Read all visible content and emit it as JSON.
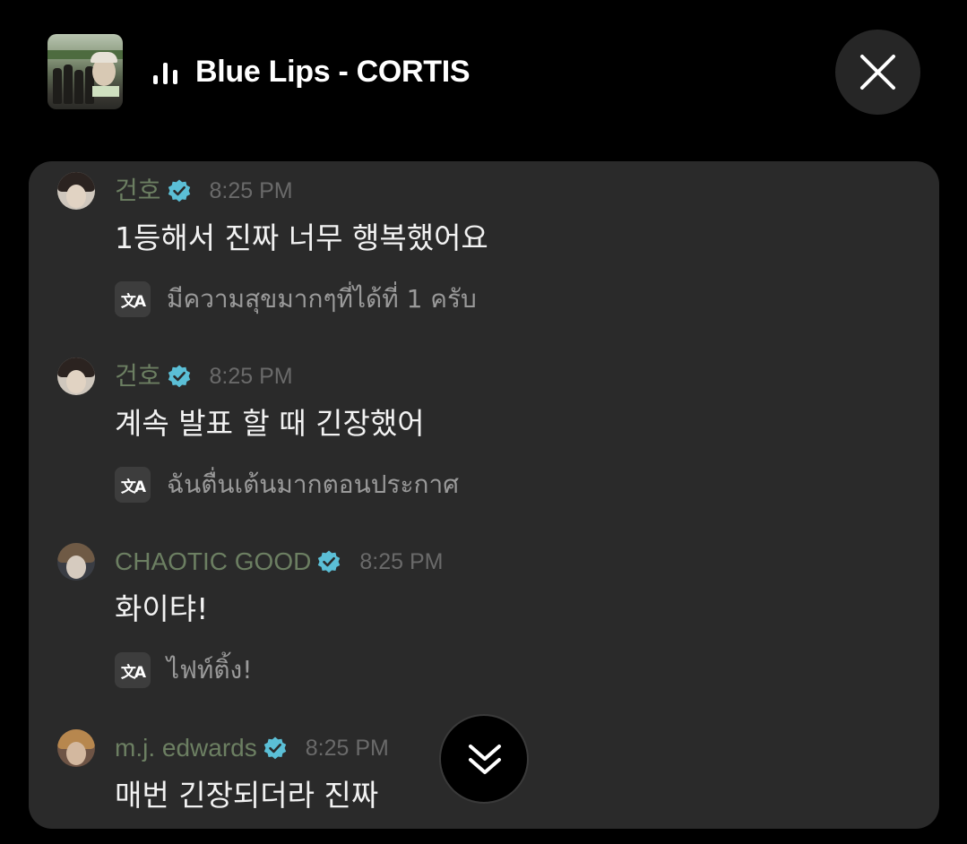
{
  "header": {
    "track_title": "Blue Lips - CORTIS",
    "now_playing_icon": "equalizer-icon",
    "album_art": "album-art-thumbnail",
    "close_icon": "close-icon"
  },
  "chat": {
    "messages": [
      {
        "username": "건호",
        "verified": true,
        "time": "8:25 PM",
        "text": "1등해서 진짜 너무 행복했어요",
        "translation": "มีความสุขมากๆที่ได้ที่ 1 ครับ"
      },
      {
        "username": "건호",
        "verified": true,
        "time": "8:25 PM",
        "text": "계속 발표 할 때 긴장했어",
        "translation": "ฉันตื่นเต้นมากตอนประกาศ"
      },
      {
        "username": "CHAOTIC GOOD",
        "verified": true,
        "time": "8:25 PM",
        "text": "화이탸!",
        "translation": "ไฟท์ติ้ง!"
      },
      {
        "username": "m.j. edwards",
        "verified": true,
        "time": "8:25 PM",
        "text": "매번 긴장되더라 진짜",
        "translation": ""
      }
    ],
    "translate_icon_glyph": "文A",
    "scroll_down_icon": "double-chevron-down-icon"
  },
  "colors": {
    "background": "#000000",
    "panel": "#2a2a2a",
    "username": "#6c7f62",
    "verified_badge": "#5bbfd6",
    "timestamp": "#6a6a6a",
    "translation_text": "#9a9a9a"
  }
}
